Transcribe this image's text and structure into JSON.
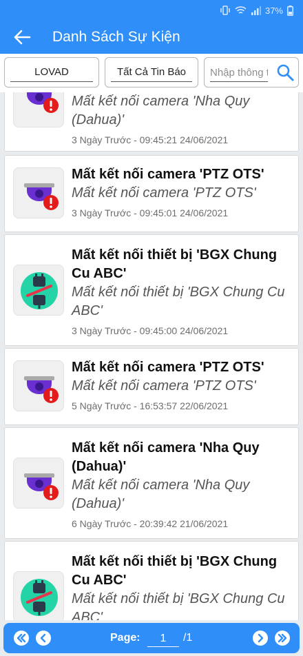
{
  "status_bar": {
    "battery": "37%"
  },
  "header": {
    "title": "Danh Sách Sự Kiện"
  },
  "filters": {
    "site": "LOVAD",
    "type": "Tất Cả Tin Báo",
    "search_placeholder": "Nhập thông tin"
  },
  "events": [
    {
      "icon": "camera-offline-icon",
      "title": "",
      "desc": "Mất kết nối camera 'Nha Quy (Dahua)'",
      "time": "3 Ngày Trước - 09:45:21 24/06/2021"
    },
    {
      "icon": "camera-offline-icon",
      "title": "Mất kết nối camera 'PTZ OTS'",
      "desc": "Mất kết nối camera 'PTZ OTS'",
      "time": "3 Ngày Trước - 09:45:01 24/06/2021"
    },
    {
      "icon": "device-disconnected-icon",
      "title": "Mất kết nối thiết bị 'BGX Chung Cu ABC'",
      "desc": "Mất kết nối thiết bị 'BGX Chung Cu ABC'",
      "time": "3 Ngày Trước - 09:45:00 24/06/2021"
    },
    {
      "icon": "camera-offline-icon",
      "title": "Mất kết nối camera 'PTZ OTS'",
      "desc": "Mất kết nối camera 'PTZ OTS'",
      "time": "5 Ngày Trước - 16:53:57 22/06/2021"
    },
    {
      "icon": "camera-offline-icon",
      "title": "Mất kết nối camera 'Nha Quy (Dahua)'",
      "desc": "Mất kết nối camera 'Nha Quy (Dahua)'",
      "time": "6 Ngày Trước - 20:39:42 21/06/2021"
    },
    {
      "icon": "device-disconnected-icon",
      "title": "Mất kết nối thiết bị 'BGX Chung Cu ABC'",
      "desc": "Mất kết nối thiết bị 'BGX Chung Cu ABC'",
      "time": ""
    }
  ],
  "pagination": {
    "label": "Page:",
    "current": "1",
    "total": "/1"
  },
  "colors": {
    "primary": "#2f8ef8",
    "alert": "#e31b1b",
    "camera_body": "#6a2fd0",
    "device_bg": "#25d4a6"
  }
}
